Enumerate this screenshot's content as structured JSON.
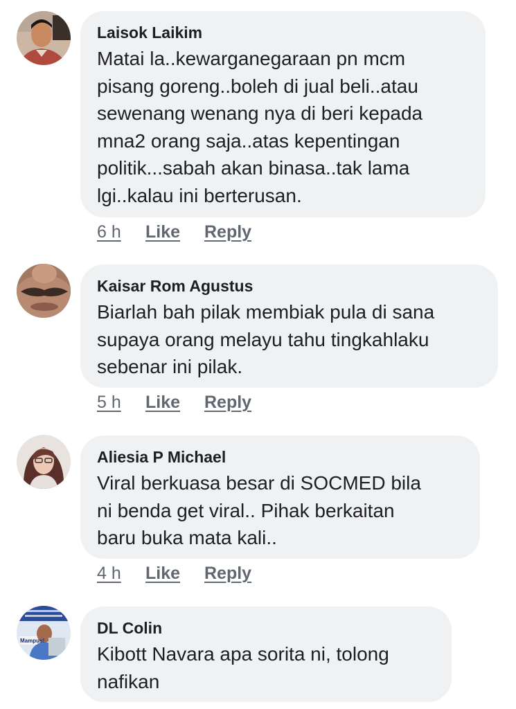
{
  "comments": [
    {
      "author": "Laisok Laikim",
      "text": "Matai la..kewarganegaraan pn mcm\npisang goreng..boleh di jual beli..atau\nsewenang wenang nya di beri kepada\nmna2 orang saja..atas kepentingan\npolitik...sabah akan binasa..tak lama\nlgi..kalau ini berterusan.",
      "time": "6 h",
      "like": "Like",
      "reply": "Reply"
    },
    {
      "author": "Kaisar Rom Agustus",
      "text": "Biarlah bah pilak membiak pula di sana\nsupaya orang melayu tahu tingkahlaku\nsebenar ini pilak.",
      "time": "5 h",
      "like": "Like",
      "reply": "Reply"
    },
    {
      "author": "Aliesia P Michael",
      "text": "Viral berkuasa besar di SOCMED bila\nni benda get viral.. Pihak berkaitan\nbaru buka mata kali..",
      "time": "4 h",
      "like": "Like",
      "reply": "Reply"
    },
    {
      "author": "DL Colin",
      "text": "Kibott Navara apa sorita ni, tolong\nnafikan"
    }
  ],
  "avatar_4_caption": "Mampus!",
  "colors": {
    "bubble": "#f0f1f3",
    "text": "#1c1e21",
    "meta": "#606770"
  }
}
